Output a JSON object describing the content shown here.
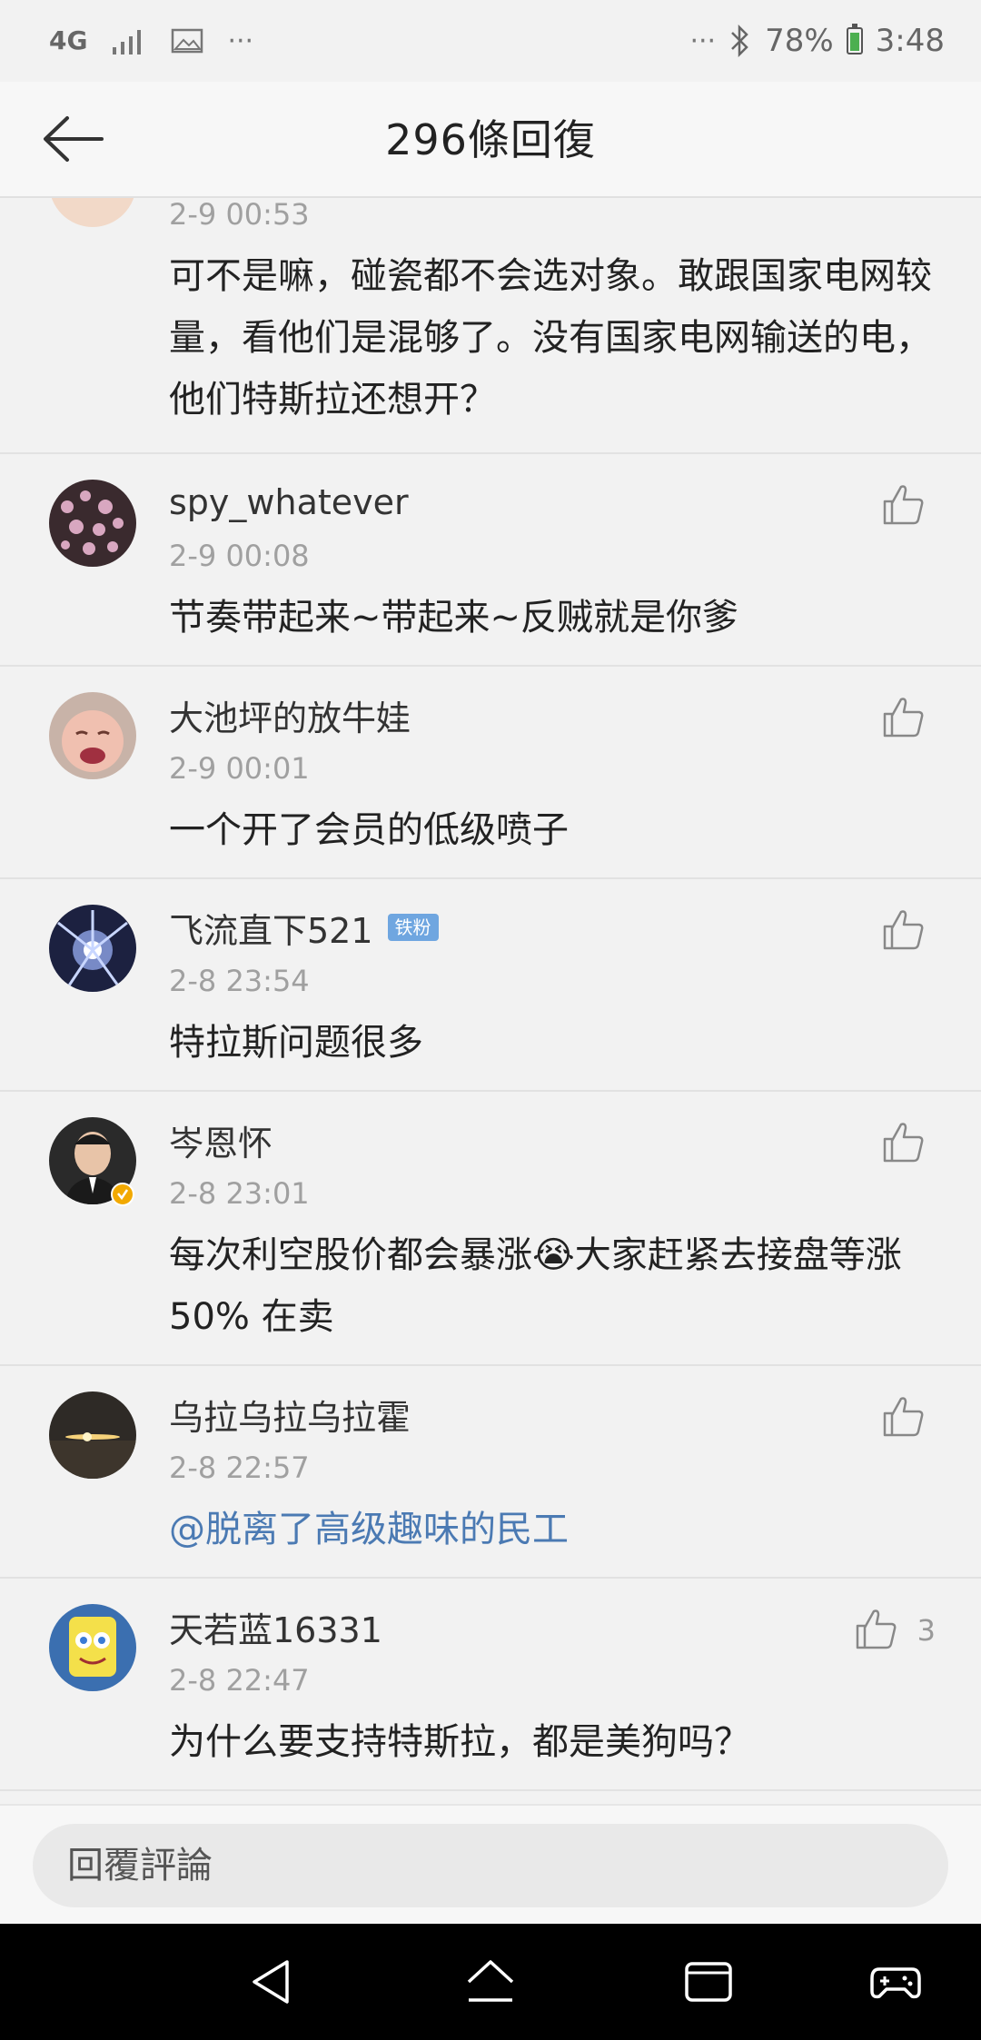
{
  "status": {
    "network": "4G",
    "battery": "78%",
    "time": "3:48"
  },
  "header": {
    "title": "296條回復"
  },
  "comments": [
    {
      "time": "2-9 00:53",
      "text": "可不是嘛，碰瓷都不会选对象。敢跟国家电网较量，看他们是混够了。没有国家电网输送的电，他们特斯拉还想开？"
    },
    {
      "name": "spy_whatever",
      "time": "2-9 00:08",
      "text": "节奏带起来~带起来~反贼就是你爹",
      "avatar": "cherry-blossom"
    },
    {
      "name": "大池坪的放牛娃",
      "time": "2-9 00:01",
      "text": "一个开了会员的低级喷子",
      "avatar": "baby"
    },
    {
      "name": "飞流直下521",
      "badge": "铁粉",
      "time": "2-8 23:54",
      "text": "特拉斯问题很多",
      "avatar": "light-burst"
    },
    {
      "name": "岑恩怀",
      "time": "2-8 23:01",
      "text": "每次利空股价都会暴涨😭大家赶紧去接盘等涨50% 在卖",
      "avatar": "man-suit",
      "verified": true
    },
    {
      "name": "乌拉乌拉乌拉霍",
      "time": "2-8 22:57",
      "text": "@脱离了高级趣味的民工",
      "avatar": "sunset"
    },
    {
      "name": "天若蓝16331",
      "time": "2-8 22:47",
      "text": "为什么要支持特斯拉，都是美狗吗？",
      "likes": "3",
      "avatar": "spongebob"
    }
  ],
  "reply": {
    "placeholder": "回覆評論"
  },
  "colors": {
    "background": "#f2f2f2",
    "mention": "#4b7ab3",
    "badge": "#6fa6e0"
  }
}
